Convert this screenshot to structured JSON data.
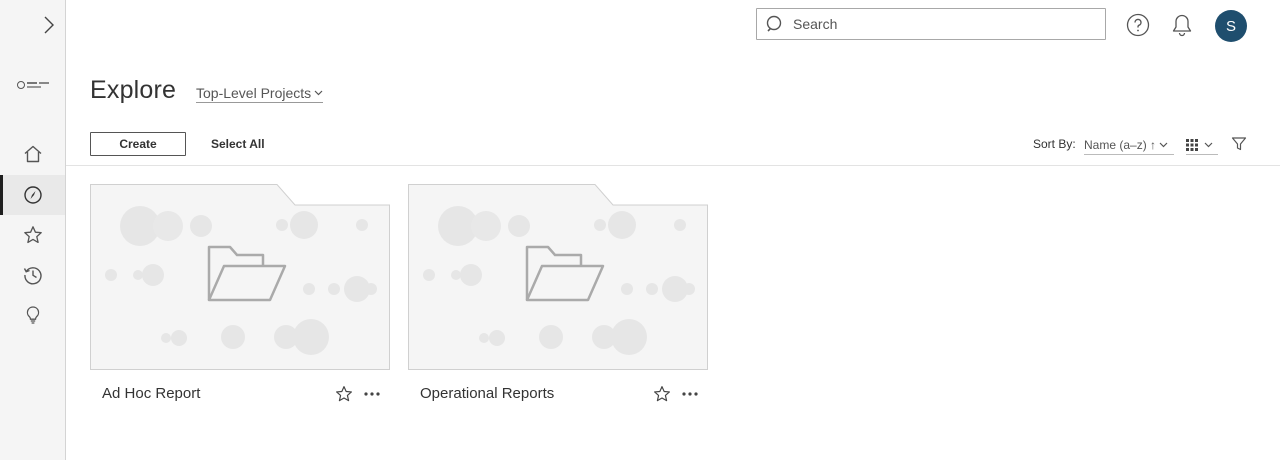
{
  "rail": {
    "toggle_icon": "chevron-right-icon",
    "logo_icon": "site-logo",
    "items": [
      {
        "name": "home",
        "icon": "home-icon",
        "active": false
      },
      {
        "name": "explore",
        "icon": "compass-icon",
        "active": true
      },
      {
        "name": "favorites",
        "icon": "star-icon",
        "active": false
      },
      {
        "name": "recents",
        "icon": "history-icon",
        "active": false
      },
      {
        "name": "recommendations",
        "icon": "lightbulb-icon",
        "active": false
      }
    ]
  },
  "header": {
    "search_placeholder": "Search",
    "help_icon": "help-icon",
    "notifications_icon": "bell-icon",
    "avatar_initial": "S",
    "avatar_color": "#1f4e6e"
  },
  "page": {
    "title": "Explore",
    "scope_label": "Top-Level Projects"
  },
  "toolbar": {
    "create_label": "Create",
    "select_all_label": "Select All",
    "sort_by_label": "Sort By:",
    "sort_value": "Name (a–z) ↑",
    "view_icon": "grid-icon",
    "filter_icon": "filter-icon"
  },
  "projects": [
    {
      "name": "Ad Hoc Report"
    },
    {
      "name": "Operational Reports"
    }
  ]
}
